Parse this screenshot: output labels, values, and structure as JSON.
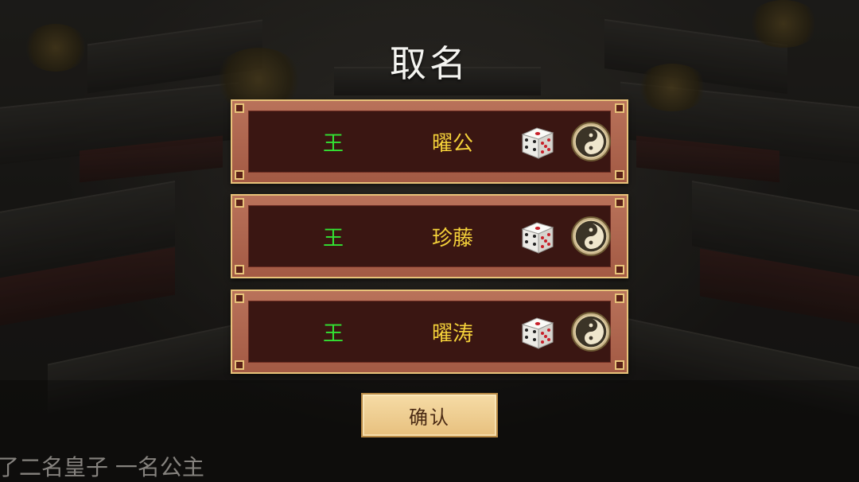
{
  "title": "取名",
  "names": [
    {
      "surname": "王",
      "given": "曜公"
    },
    {
      "surname": "王",
      "given": "珍藤"
    },
    {
      "surname": "王",
      "given": "曜涛"
    }
  ],
  "icons": {
    "randomize": "dice-icon",
    "fortune": "yin-yang-icon"
  },
  "confirm_label": "确认",
  "caption": "了二名皇子 一名公主",
  "colors": {
    "surname": "#33e233",
    "given_name": "#f5d23a",
    "panel_border": "#e8c37a",
    "panel_fill": "#3a1612",
    "button_bg": "#f0d096"
  }
}
